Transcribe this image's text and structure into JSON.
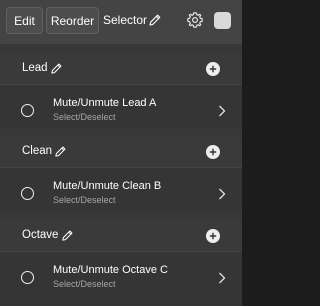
{
  "toolbar": {
    "edit_label": "Edit",
    "reorder_label": "Reorder",
    "title": "Selector"
  },
  "groups": [
    {
      "label": "Lead",
      "item_title": "Mute/Unmute Lead A",
      "item_subtitle": "Select/Deselect"
    },
    {
      "label": "Clean",
      "item_title": "Mute/Unmute Clean B",
      "item_subtitle": "Select/Deselect"
    },
    {
      "label": "Octave",
      "item_title": "Mute/Unmute Octave C",
      "item_subtitle": "Select/Deselect"
    }
  ],
  "icons": {
    "pencil": "pencil-icon",
    "gear": "gear-icon",
    "add": "plus-circle-icon",
    "radio": "radio-circle-icon",
    "chevron": "chevron-right-icon"
  },
  "colors": {
    "toolbar_bg": "#444444",
    "list_bg": "#353535",
    "header_bg": "#3a3a3a",
    "subtitle_text": "#a6a6a6"
  }
}
